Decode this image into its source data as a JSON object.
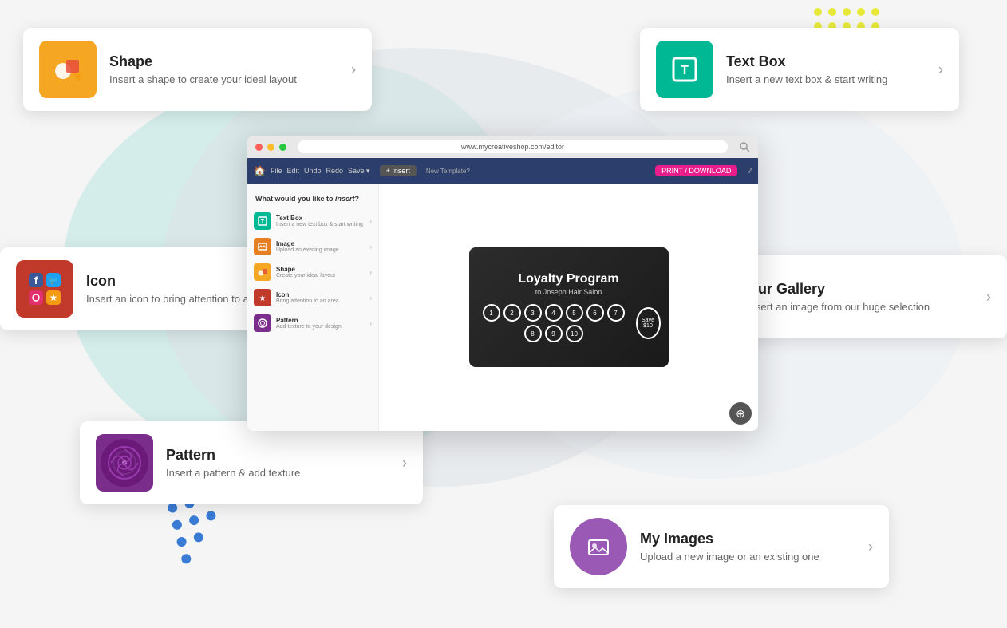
{
  "background": {
    "color": "#f5f5f5"
  },
  "cards": {
    "shape": {
      "title": "Shape",
      "description": "Insert a shape to create your ideal layout",
      "icon_color": "#f5a623",
      "arrow": "›"
    },
    "textbox": {
      "title": "Text Box",
      "description": "Insert a new text box & start writing",
      "icon_color": "#00b894",
      "arrow": "›"
    },
    "icon": {
      "title": "Icon",
      "description": "Insert an icon to bring attention to an area",
      "icon_color": "#c0392b",
      "arrow": "›"
    },
    "gallery": {
      "title": "Our Gallery",
      "description": "Insert an image from our huge selection",
      "icon_color": "#2c3e6b",
      "arrow": "›"
    },
    "pattern": {
      "title": "Pattern",
      "description": "Insert a pattern & add texture",
      "icon_color": "#7b2d8b",
      "arrow": "›"
    },
    "myimages": {
      "title": "My Images",
      "description": "Upload a new image or an existing one",
      "icon_color": "#9b59b6",
      "arrow": "›"
    }
  },
  "browser": {
    "url": "www.mycreativeshop.com/editor",
    "nav_items": [
      "File",
      "Edit",
      "Undo",
      "Redo",
      "Save"
    ],
    "insert_btn": "+ Insert",
    "print_btn": "PRINT / DOWNLOAD",
    "question": "What would you like to insert?",
    "sidebar_items": [
      {
        "label": "Text Box",
        "desc": "Insert a new text box & start writing",
        "color": "#00b894"
      },
      {
        "label": "Image",
        "desc": "Upload an existing image",
        "color": "#e67e22"
      },
      {
        "label": "Shape",
        "desc": "Create your ideal layout",
        "color": "#f5a623"
      },
      {
        "label": "Icon",
        "desc": "Bring attention to an area",
        "color": "#c0392b"
      },
      {
        "label": "Pattern",
        "desc": "Add texture to your design",
        "color": "#7b2d8b"
      }
    ],
    "loyalty": {
      "title": "Loyalty Program",
      "subtitle": "to Joseph Hair Salon",
      "circles": [
        "1",
        "2",
        "3",
        "4",
        "5",
        "6",
        "7",
        "8",
        "9",
        "10"
      ],
      "save_label": "Save",
      "save_amount": "$10"
    }
  }
}
